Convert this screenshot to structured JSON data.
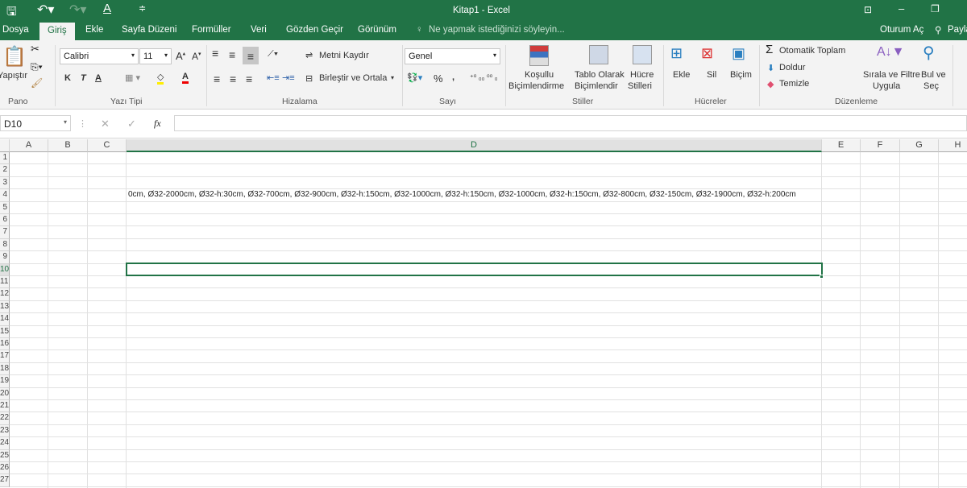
{
  "title": "Kitap1 - Excel",
  "tabs": [
    "Dosya",
    "Giriş",
    "Ekle",
    "Sayfa Düzeni",
    "Formüller",
    "Veri",
    "Gözden Geçir",
    "Görünüm"
  ],
  "tell_me": "Ne yapmak istediğinizi söyleyin...",
  "sign_in": "Oturum Aç",
  "share": "Payla",
  "ribbon": {
    "paste": "Yapıştır",
    "font": "Calibri",
    "size": "11",
    "bold": "K",
    "italic": "T",
    "underline": "A",
    "wrap": "Metni Kaydır",
    "merge": "Birleştir ve Ortala",
    "number_format": "Genel",
    "cond1": "Koşullu",
    "cond2": "Biçimlendirme",
    "table1": "Tablo Olarak",
    "table2": "Biçimlendir",
    "cell1": "Hücre",
    "cell2": "Stilleri",
    "insert": "Ekle",
    "delete": "Sil",
    "format": "Biçim",
    "autosum": "Otomatik Toplam",
    "fill": "Doldur",
    "clear": "Temizle",
    "sort1": "Sırala ve Filtre",
    "sort2": "Uygula",
    "find1": "Bul ve",
    "find2": "Seç",
    "groups": {
      "clipboard": "Pano",
      "font": "Yazı Tipi",
      "alignment": "Hizalama",
      "number": "Sayı",
      "styles": "Stiller",
      "cells": "Hücreler",
      "editing": "Düzenleme"
    }
  },
  "formula_bar": {
    "name_box": "D10",
    "fx": "fx",
    "value": ""
  },
  "columns": [
    "A",
    "B",
    "C",
    "D",
    "E",
    "F",
    "G",
    "H"
  ],
  "rows": [
    "1",
    "2",
    "3",
    "4",
    "5",
    "6",
    "7",
    "8",
    "9",
    "10",
    "11",
    "12",
    "13",
    "14",
    "15",
    "16",
    "17",
    "18",
    "19",
    "20",
    "21",
    "22",
    "23",
    "24",
    "25",
    "26",
    "27"
  ],
  "cells": {
    "D4": "0cm, Ø32-2000cm, Ø32-h:30cm, Ø32-700cm, Ø32-900cm, Ø32-h:150cm, Ø32-1000cm, Ø32-h:150cm, Ø32-1000cm, Ø32-h:150cm, Ø32-800cm, Ø32-150cm, Ø32-1900cm, Ø32-h:200cm"
  },
  "selected_cell": "D10",
  "accent": "#217346"
}
